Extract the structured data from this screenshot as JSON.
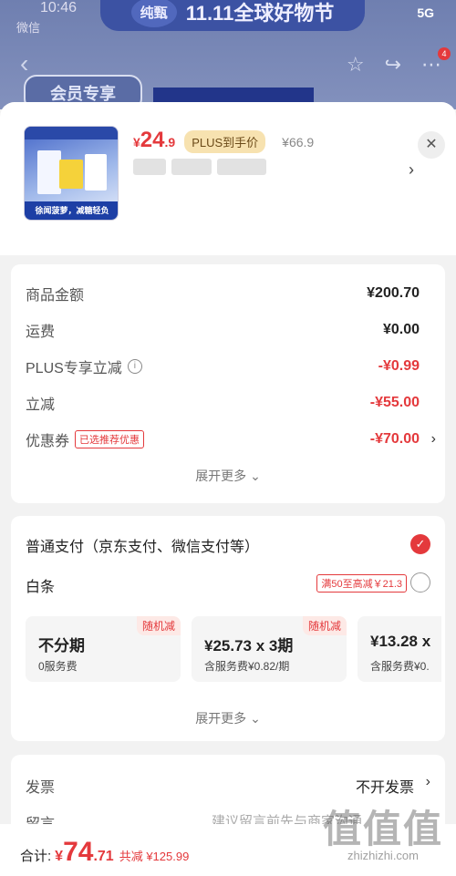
{
  "status_bar": {
    "time": "10:46",
    "app": "微信",
    "network": "5G"
  },
  "background": {
    "banner": "11.11全球好物节",
    "brand": "纯甄",
    "member_label": "会员专享",
    "cart_badge": "4"
  },
  "product": {
    "price_yen": "¥",
    "price_main": "24",
    "price_dec": ".9",
    "plus_label": "PLUS到手价",
    "original_price": "¥66.9",
    "thumb_caption": "徐闻菠萝，减糖轻负"
  },
  "amounts": {
    "rows": [
      {
        "label": "商品金额",
        "value": "¥200.70"
      },
      {
        "label": "运费",
        "value": "¥0.00"
      },
      {
        "label": "PLUS专享立减",
        "value": "-¥0.99"
      },
      {
        "label": "立减",
        "value": "-¥55.00"
      },
      {
        "label": "优惠券",
        "value": "-¥70.00",
        "tag": "已选推荐优惠"
      }
    ],
    "expand_label": "展开更多"
  },
  "payment": {
    "normal_label": "普通支付（京东支付、微信支付等）",
    "baitiao_label": "白条",
    "baitiao_promo": "满50至高减￥21.3",
    "plans": [
      {
        "title": "不分期",
        "sub": "0服务费",
        "tag": "随机减"
      },
      {
        "title": "¥25.73 x 3期",
        "sub": "含服务费¥0.82/期",
        "tag": "随机减"
      },
      {
        "title": "¥13.28 x",
        "sub": "含服务费¥0.",
        "tag": ""
      }
    ],
    "expand_label": "展开更多"
  },
  "invoice": {
    "label": "发票",
    "value": "不开发票",
    "note_label": "留言",
    "note_placeholder": "建议留言前先与商家沟通"
  },
  "footer": {
    "total_label": "合计:",
    "yen": "¥",
    "total_int": "74",
    "total_dec": ".71",
    "saved": "共减 ¥125.99"
  },
  "watermark": {
    "logo": "值值值",
    "url": "zhizhizhi.com"
  },
  "colors": {
    "accent": "#e4393c",
    "plus": "#f7e2b0"
  }
}
